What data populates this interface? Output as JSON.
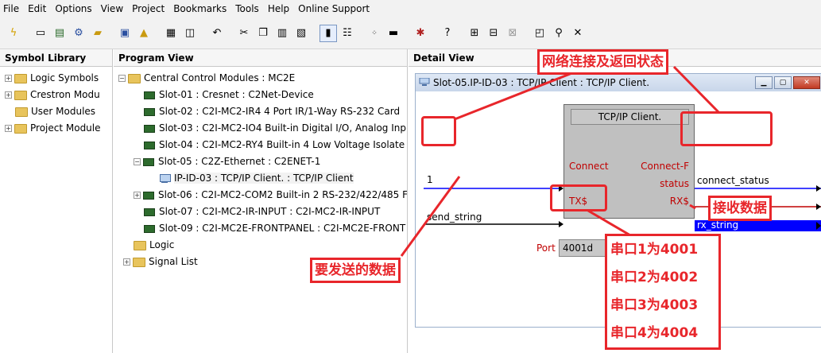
{
  "menu": [
    "File",
    "Edit",
    "Options",
    "View",
    "Project",
    "Bookmarks",
    "Tools",
    "Help",
    "Online Support"
  ],
  "toolbar": {
    "icons": [
      "lightning-icon",
      "new-file-icon",
      "new-program-icon",
      "settings-icon",
      "open-folder-icon",
      "save-icon",
      "lock-icon",
      "print-icon",
      "print-preview-icon",
      "undo-icon",
      "cut-icon",
      "copy-icon",
      "paste-icon",
      "paste-special-icon",
      "debugger-icon",
      "view-icon",
      "numbers-icon",
      "compile-icon",
      "transfer-icon",
      "help-icon",
      "grid-icon",
      "layout-icon",
      "layout2-icon",
      "window-icon",
      "pin-icon",
      "close-x-icon"
    ]
  },
  "symbol_library": {
    "header": "Symbol Library",
    "items": [
      {
        "label": "Logic Symbols",
        "expandable": true
      },
      {
        "label": "Crestron Modu",
        "expandable": true
      },
      {
        "label": "User Modules",
        "expandable": false
      },
      {
        "label": "Project Module",
        "expandable": true
      }
    ]
  },
  "program_view": {
    "header": "Program View",
    "root": "Central Control Modules : MC2E",
    "slots": [
      {
        "label": "Slot-01 : Cresnet : C2Net-Device",
        "expandable": false
      },
      {
        "label": "Slot-02 : C2I-MC2-IR4 4 Port IR/1-Way RS-232 Card",
        "expandable": false
      },
      {
        "label": "Slot-03 : C2I-MC2-IO4 Built-in Digital I/O, Analog Inp",
        "expandable": false
      },
      {
        "label": "Slot-04 : C2I-MC2-RY4 Built-in 4 Low Voltage Isolate",
        "expandable": false
      },
      {
        "label": "Slot-05 : C2Z-Ethernet : C2ENET-1",
        "expandable": true
      },
      {
        "label": "Slot-06 : C2I-MC2-COM2 Built-in 2 RS-232/422/485 F",
        "expandable": true
      },
      {
        "label": "Slot-07 : C2I-MC2-IR-INPUT : C2I-MC2-IR-INPUT",
        "expandable": false
      },
      {
        "label": "Slot-09 : C2I-MC2E-FRONTPANEL : C2I-MC2E-FRONT",
        "expandable": false
      }
    ],
    "child": "IP-ID-03 : TCP/IP Client. : TCP/IP Client",
    "extras": [
      {
        "label": "Logic",
        "expandable": false
      },
      {
        "label": "Signal List",
        "expandable": true
      }
    ]
  },
  "detail_view": {
    "header": "Detail View",
    "window_title": "Slot-05.IP-ID-03 : TCP/IP Client : TCP/IP Client.",
    "symbol": {
      "title": "TCP/IP Client.",
      "inputs": [
        "Connect",
        "TX$"
      ],
      "outputs": [
        "Connect-F",
        "status",
        "RX$"
      ],
      "param_label": "Port",
      "param_value": "4001d"
    },
    "signals": {
      "connect_in": "1",
      "tx_in": "send_string",
      "connect_out": "connect_status",
      "rx_out": "rx_string"
    }
  },
  "annotations": {
    "top": "网络连接及返回状态",
    "receive": "接收数据",
    "send": "要发送的数据",
    "ports": [
      "串口1为4001",
      "串口2为4002",
      "串口3为4003",
      "串口4为4004"
    ]
  },
  "colors": {
    "annotation": "#e8262b",
    "selected_signal": "#0000ff",
    "pin_label": "#c00000"
  }
}
